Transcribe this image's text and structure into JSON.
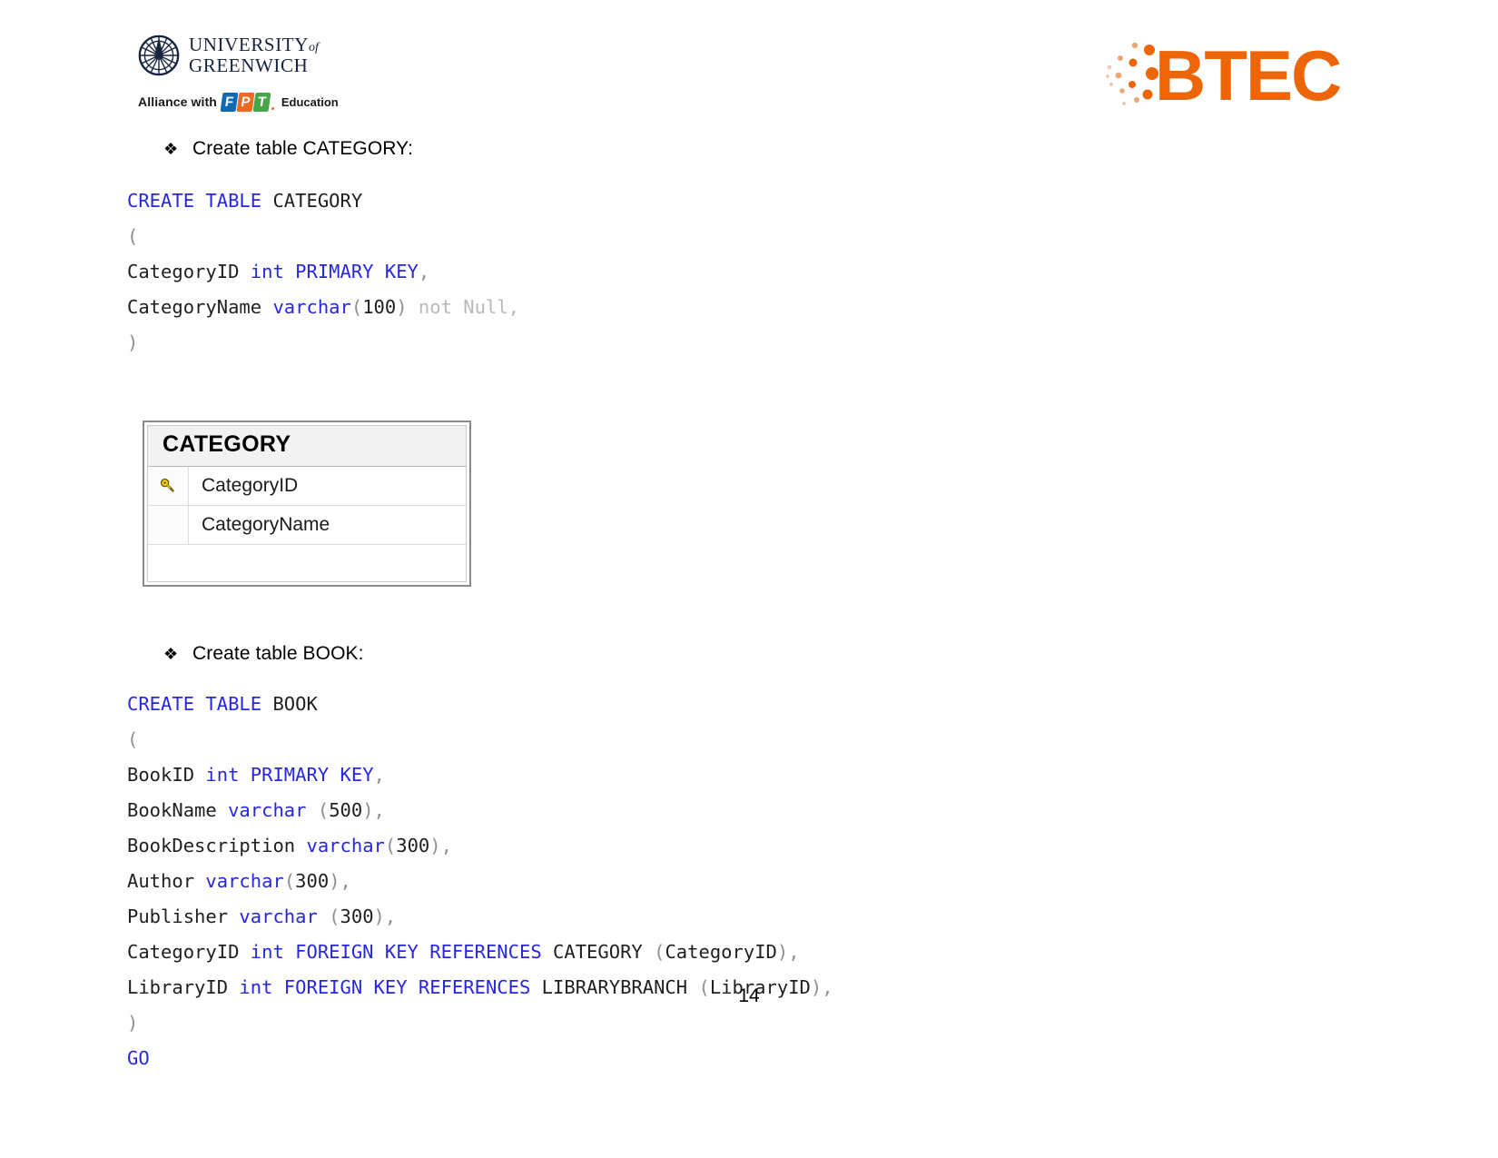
{
  "header": {
    "university": {
      "line1": "UNIVERSITY",
      "line1_suffix": "of",
      "line2": "GREENWICH",
      "logo_icon": "compass-rose-icon"
    },
    "alliance": {
      "prefix": "Alliance with",
      "brand_letters": [
        "F",
        "P",
        "T"
      ],
      "suffix": "Education"
    },
    "btec": {
      "text": "BTEC",
      "color": "#ec6608",
      "icon": "btec-dots-icon"
    }
  },
  "sections": [
    {
      "bullet": "❖",
      "heading": "Create table CATEGORY:",
      "code_lines": [
        [
          {
            "t": "CREATE TABLE ",
            "c": "kw"
          },
          {
            "t": "CATEGORY",
            "c": "id"
          }
        ],
        [
          {
            "t": "(",
            "c": "punc"
          }
        ],
        [
          {
            "t": "CategoryID ",
            "c": "id"
          },
          {
            "t": "int PRIMARY KEY",
            "c": "kw"
          },
          {
            "t": ",",
            "c": "punc"
          }
        ],
        [
          {
            "t": "CategoryName ",
            "c": "id"
          },
          {
            "t": "varchar",
            "c": "kw"
          },
          {
            "t": "(",
            "c": "punc"
          },
          {
            "t": "100",
            "c": "id"
          },
          {
            "t": ") ",
            "c": "punc"
          },
          {
            "t": "not Null,",
            "c": "dim"
          }
        ],
        [
          {
            "t": ")",
            "c": "punc"
          }
        ]
      ]
    },
    {
      "bullet": "❖",
      "heading": "Create table BOOK:",
      "code_lines": [
        [
          {
            "t": "CREATE TABLE ",
            "c": "kw"
          },
          {
            "t": "BOOK",
            "c": "id"
          }
        ],
        [
          {
            "t": "(",
            "c": "punc"
          }
        ],
        [
          {
            "t": "BookID ",
            "c": "id"
          },
          {
            "t": "int PRIMARY KEY",
            "c": "kw"
          },
          {
            "t": ",",
            "c": "punc"
          }
        ],
        [
          {
            "t": "BookName ",
            "c": "id"
          },
          {
            "t": "varchar",
            "c": "kw"
          },
          {
            "t": " (",
            "c": "punc"
          },
          {
            "t": "500",
            "c": "id"
          },
          {
            "t": "),",
            "c": "punc"
          }
        ],
        [
          {
            "t": "BookDescription ",
            "c": "id"
          },
          {
            "t": "varchar",
            "c": "kw"
          },
          {
            "t": "(",
            "c": "punc"
          },
          {
            "t": "300",
            "c": "id"
          },
          {
            "t": "),",
            "c": "punc"
          }
        ],
        [
          {
            "t": "Author ",
            "c": "id"
          },
          {
            "t": "varchar",
            "c": "kw"
          },
          {
            "t": "(",
            "c": "punc"
          },
          {
            "t": "300",
            "c": "id"
          },
          {
            "t": "),",
            "c": "punc"
          }
        ],
        [
          {
            "t": "Publisher ",
            "c": "id"
          },
          {
            "t": "varchar",
            "c": "kw"
          },
          {
            "t": " (",
            "c": "punc"
          },
          {
            "t": "300",
            "c": "id"
          },
          {
            "t": "),",
            "c": "punc"
          }
        ],
        [
          {
            "t": "CategoryID ",
            "c": "id"
          },
          {
            "t": "int FOREIGN KEY REFERENCES ",
            "c": "kw"
          },
          {
            "t": "CATEGORY ",
            "c": "id"
          },
          {
            "t": "(",
            "c": "punc"
          },
          {
            "t": "CategoryID",
            "c": "id"
          },
          {
            "t": "),",
            "c": "punc"
          }
        ],
        [
          {
            "t": "LibraryID ",
            "c": "id"
          },
          {
            "t": "int FOREIGN KEY REFERENCES ",
            "c": "kw"
          },
          {
            "t": "LIBRARYBRANCH ",
            "c": "id"
          },
          {
            "t": "(",
            "c": "punc"
          },
          {
            "t": "LibraryID",
            "c": "id"
          },
          {
            "t": "),",
            "c": "punc"
          }
        ],
        [
          {
            "t": ")",
            "c": "punc"
          }
        ],
        [
          {
            "t": "GO",
            "c": "kw"
          }
        ]
      ]
    }
  ],
  "erd": {
    "title": "CATEGORY",
    "rows": [
      {
        "field": "CategoryID",
        "key": true,
        "key_icon": "primary-key-icon"
      },
      {
        "field": "CategoryName",
        "key": false,
        "key_icon": ""
      }
    ]
  },
  "footer": {
    "page_number": "14"
  }
}
